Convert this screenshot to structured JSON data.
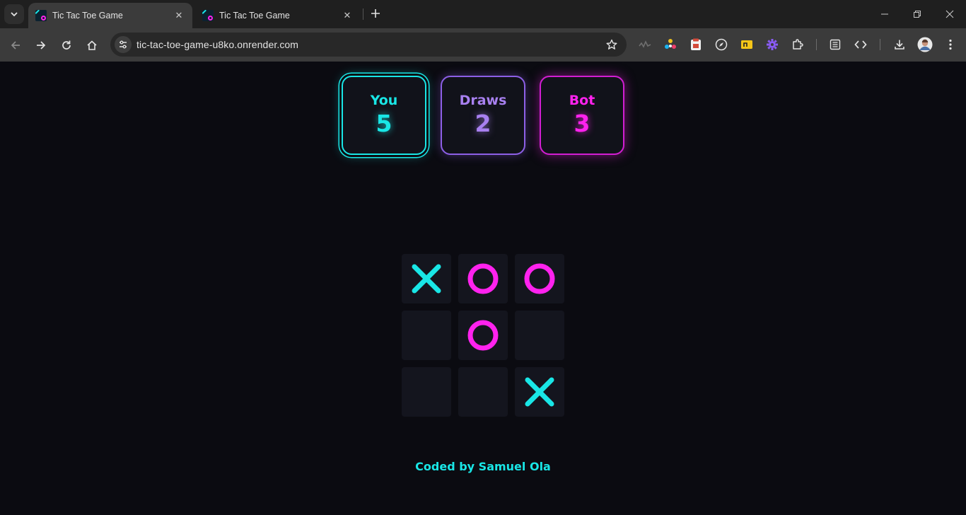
{
  "browser": {
    "tabs": [
      {
        "title": "Tic Tac Toe Game",
        "active": true
      },
      {
        "title": "Tic Tac Toe Game",
        "active": false
      }
    ],
    "url": "tic-tac-toe-game-u8ko.onrender.com"
  },
  "scoreboard": {
    "you": {
      "label": "You",
      "value": "5",
      "color": "#19e6e6"
    },
    "draws": {
      "label": "Draws",
      "value": "2",
      "color": "#a880f0"
    },
    "bot": {
      "label": "Bot",
      "value": "3",
      "color": "#ff22ee"
    }
  },
  "board": {
    "cells": [
      "X",
      "O",
      "O",
      "",
      "O",
      "",
      "",
      "",
      "X"
    ],
    "x_color": "#19e6e6",
    "o_color": "#ff22ee"
  },
  "footer": {
    "credit": "Coded by Samuel Ola"
  }
}
